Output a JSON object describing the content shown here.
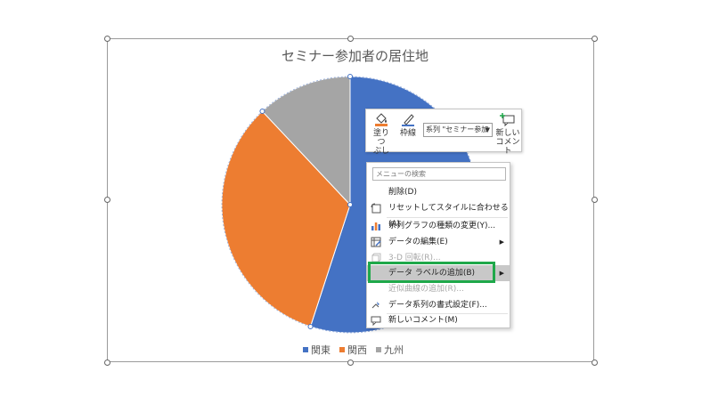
{
  "chart": {
    "title": "セミナー参加者の居住地",
    "legend": [
      {
        "label": "関東",
        "color": "#4472c4"
      },
      {
        "label": "関西",
        "color": "#ed7d31"
      },
      {
        "label": "九州",
        "color": "#a5a5a5"
      }
    ]
  },
  "chart_data": {
    "type": "pie",
    "title": "セミナー参加者の居住地",
    "categories": [
      "関東",
      "関西",
      "九州"
    ],
    "values": [
      55,
      33,
      12
    ],
    "colors": [
      "#4472c4",
      "#ed7d31",
      "#a5a5a5"
    ],
    "legend_position": "bottom"
  },
  "toolbar": {
    "fill_label_1": "塗りつ",
    "fill_label_2": "ぶし",
    "outline_label": "枠線",
    "series_select": "系列 \"セミナー参加",
    "new_comment_label_1": "新しい",
    "new_comment_label_2": "コメント"
  },
  "context_menu": {
    "search_placeholder": "メニューの検索",
    "items": [
      {
        "label": "削除(D)"
      },
      {
        "label": "リセットしてスタイルに合わせる(A)"
      },
      {
        "label": "系列グラフの種類の変更(Y)..."
      },
      {
        "label": "データの編集(E)"
      },
      {
        "label": "3-D 回転(R)..."
      },
      {
        "label": "データ ラベルの追加(B)"
      },
      {
        "label": "近似曲線の追加(R)..."
      },
      {
        "label": "データ系列の書式設定(F)..."
      },
      {
        "label": "新しいコメント(M)"
      }
    ]
  }
}
